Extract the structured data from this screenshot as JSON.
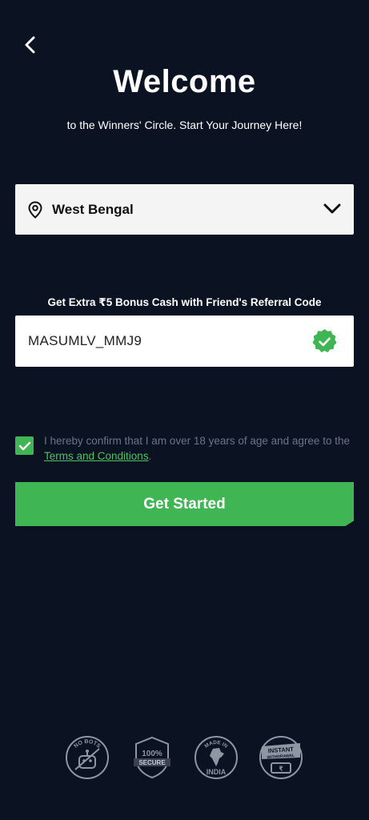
{
  "header": {
    "title": "Welcome",
    "subtitle": "to the Winners' Circle. Start Your Journey Here!"
  },
  "state": {
    "selected": "West Bengal"
  },
  "referral": {
    "label": "Get Extra ₹5 Bonus Cash with Friend's Referral Code",
    "value": "MASUMLV_MMJ9",
    "verified": true
  },
  "consent": {
    "checked": true,
    "text": "I hereby confirm that I am over 18 years of age and agree to the",
    "link": "Terms and Conditions",
    "suffix": "."
  },
  "cta": {
    "label": "Get Started"
  },
  "badges": {
    "no_bots": "NO BOTS",
    "secure": "100% SECURE",
    "india_top": "MADE IN",
    "india": "INDIA",
    "instant": "INSTANT",
    "withdrawal": "WITHDRAWAL",
    "rupee": "₹"
  },
  "colors": {
    "background": "#0b1323",
    "accent": "#3fb554",
    "muted": "#6b7487"
  }
}
